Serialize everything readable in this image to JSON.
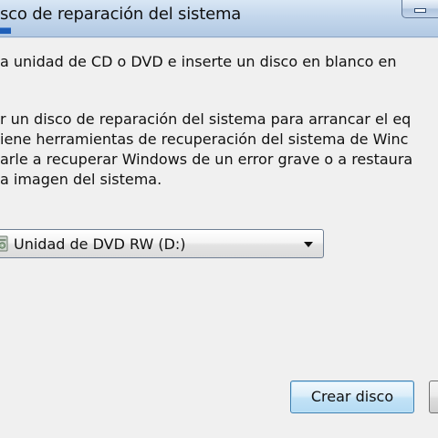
{
  "window": {
    "title": "sco de reparación del sistema"
  },
  "dialog": {
    "instruction": "a unidad de CD o DVD e inserte un disco en blanco en",
    "description_lines": [
      "r un disco de reparación del sistema para arrancar el eq",
      "iene herramientas de recuperación del sistema de Winc",
      "arle a recuperar Windows de un error grave o a restaura",
      "a imagen del sistema."
    ]
  },
  "drive_select": {
    "selected": "Unidad de DVD RW (D:)",
    "icon": "optical-drive-icon"
  },
  "buttons": {
    "create_label": "Crear disco"
  },
  "colors": {
    "title_bar": "#c4d7ec",
    "client_bg": "#f0f0f0",
    "default_button_border": "#3c7fb1"
  }
}
